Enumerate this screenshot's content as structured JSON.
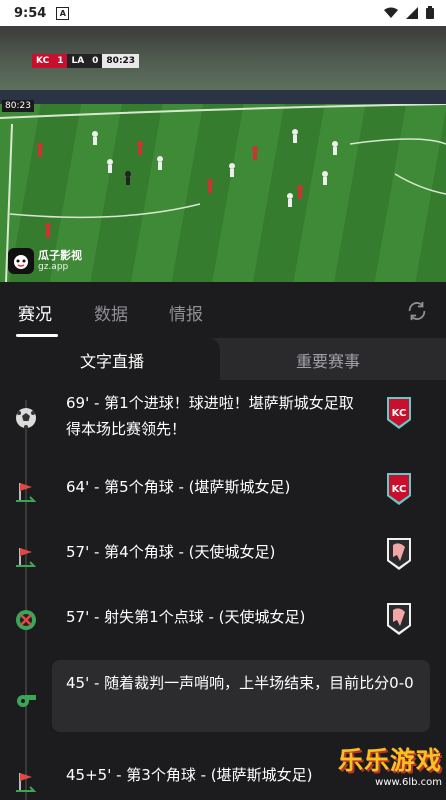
{
  "status_bar": {
    "time": "9:54",
    "a_icon": "A"
  },
  "video": {
    "score": {
      "home": "KC",
      "home_score": "1",
      "away": "LA",
      "away_score": "0",
      "clock": "80:23"
    },
    "secondary_clock": "80:23",
    "watermark": {
      "name": "瓜子影视",
      "domain": "gz.app"
    }
  },
  "tabs": [
    {
      "label": "赛况",
      "active": true
    },
    {
      "label": "数据",
      "active": false
    },
    {
      "label": "情报",
      "active": false
    }
  ],
  "subtabs": [
    {
      "label": "文字直播",
      "active": true
    },
    {
      "label": "重要赛事",
      "active": false
    }
  ],
  "events": [
    {
      "text": "69' - 第1个进球！球进啦！堪萨斯城女足取得本场比赛领先！",
      "icon": "soccer-ball-icon",
      "team": "KC"
    },
    {
      "text": "64' - 第5个角球 - (堪萨斯城女足)",
      "icon": "corner-flag-icon",
      "team": "KC"
    },
    {
      "text": "57' - 第4个角球 - (天使城女足)",
      "icon": "corner-flag-icon",
      "team": "LA"
    },
    {
      "text": "57' - 射失第1个点球 - (天使城女足)",
      "icon": "missed-penalty-icon",
      "team": "LA"
    },
    {
      "text": "45' - 随着裁判一声哨响，上半场结束，目前比分0-0",
      "icon": "whistle-icon",
      "team": ""
    },
    {
      "text": "45+5' - 第3个角球 - (堪萨斯城女足)",
      "icon": "corner-flag-icon",
      "team": "KC"
    }
  ],
  "brand": {
    "main": "乐乐游戏",
    "sub": "www.6lb.com"
  }
}
